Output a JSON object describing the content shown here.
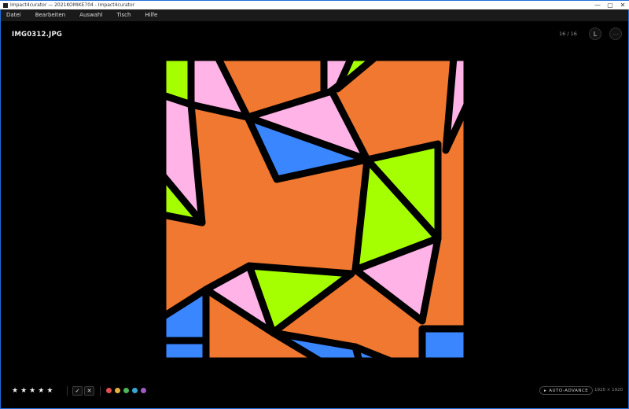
{
  "window": {
    "title": "Impact4curator — 2021KOMIKE704 - Impact4curator",
    "minimize_glyph": "—",
    "maximize_glyph": "▢",
    "close_glyph": "✕"
  },
  "menu": [
    "Datei",
    "Bearbeiten",
    "Auswahl",
    "Tisch",
    "Hilfe"
  ],
  "viewer": {
    "filename": "IMG0312.JPG",
    "counter": "16 / 16",
    "loupe_label": "L",
    "more_glyph": "⋯"
  },
  "image": {
    "icon": "triangle-pattern-image",
    "palette": {
      "orange": "#f07830",
      "pink": "#ffb3e6",
      "lime": "#a6ff00",
      "blue": "#3a86ff",
      "outline": "#000000"
    }
  },
  "bottom": {
    "rating": {
      "stars": [
        "★",
        "★",
        "★",
        "★",
        "★"
      ],
      "value": 5
    },
    "accept_glyph": "✓",
    "reject_glyph": "✕",
    "color_labels": [
      {
        "name": "red",
        "color": "#e0524f"
      },
      {
        "name": "yellow",
        "color": "#e6b03a"
      },
      {
        "name": "green",
        "color": "#4cb45a"
      },
      {
        "name": "blue",
        "color": "#3aa6d6"
      },
      {
        "name": "purple",
        "color": "#9a5cc6"
      }
    ],
    "auto_advance_label": "AUTO-ADVANCE",
    "dimensions": "1920 × 1920"
  }
}
